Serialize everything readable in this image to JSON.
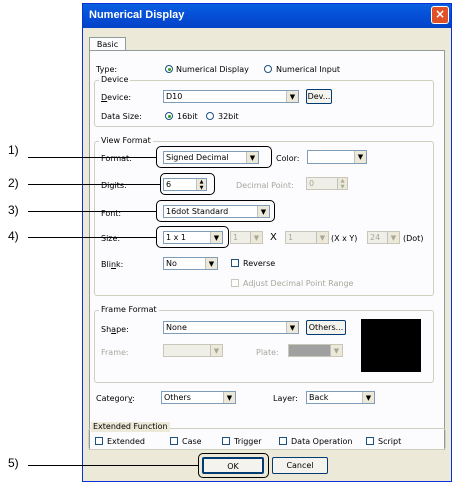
{
  "dialog": {
    "title": "Numerical Display",
    "close_label": "×"
  },
  "tabs": [
    "Basic"
  ],
  "type": {
    "label": "Type:",
    "options": [
      "Numerical Display",
      "Numerical Input"
    ],
    "selected": "Numerical Display"
  },
  "device": {
    "group_label": "Device",
    "device_label": "Device:",
    "device_value": "D10",
    "dev_button": "Dev...",
    "data_size_label": "Data Size:",
    "sizes": [
      "16bit",
      "32bit"
    ],
    "selected_size": "16bit"
  },
  "view_format": {
    "group_label": "View Format",
    "format_label": "Format:",
    "format_value": "Signed Decimal",
    "color_label": "Color:",
    "color_value": "",
    "digits_label": "Digits:",
    "digits_value": "6",
    "decimal_point_label": "Decimal Point:",
    "decimal_point_value": "0",
    "font_label": "Font:",
    "font_value": "16dot Standard",
    "size_label": "Size:",
    "size_value": "1 x 1",
    "size_x_value": "1",
    "size_times": "X",
    "size_y_value": "1",
    "size_xy_label": "(X x Y)",
    "dot_value": "24",
    "dot_label": "(Dot)",
    "blink_label": "Blink:",
    "blink_value": "No",
    "reverse_label": "Reverse",
    "adjust_label": "Adjust Decimal Point Range"
  },
  "frame_format": {
    "group_label": "Frame Format",
    "shape_label": "Shape:",
    "shape_value": "None",
    "others_button": "Others...",
    "frame_label": "Frame:",
    "plate_label": "Plate:",
    "preview_color": "#000000"
  },
  "category": {
    "label": "Category:",
    "value": "Others"
  },
  "layer": {
    "label": "Layer:",
    "value": "Back"
  },
  "extended": {
    "group_label": "Extended Function",
    "options": [
      "Extended",
      "Case",
      "Trigger",
      "Data Operation",
      "Script"
    ]
  },
  "buttons": {
    "ok": "OK",
    "cancel": "Cancel"
  },
  "callouts": [
    "1)",
    "2)",
    "3)",
    "4)",
    "5)"
  ],
  "colors": {
    "title_bar": "#0550d8",
    "dialog_bg": "#ece9d8",
    "close": "#e0512a"
  }
}
